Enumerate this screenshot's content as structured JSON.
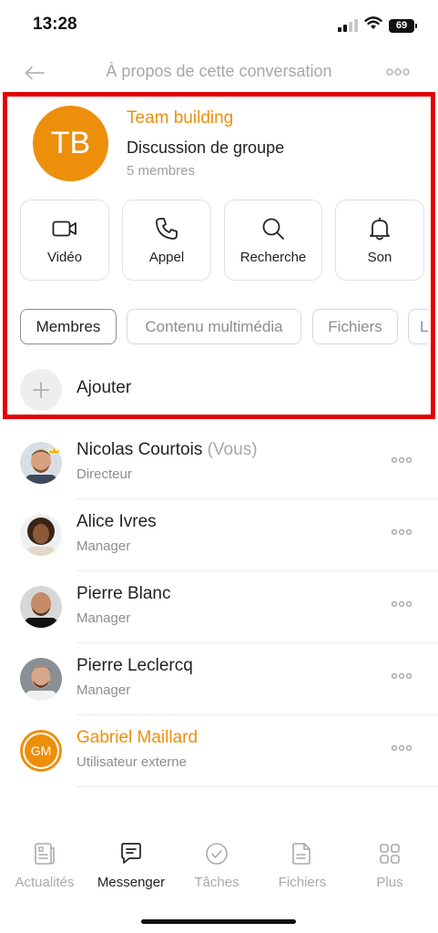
{
  "status_bar": {
    "time": "13:28",
    "battery": "69",
    "icons": [
      "signal-icon",
      "wifi-icon",
      "battery-icon"
    ]
  },
  "header": {
    "title": "À propos de cette conversation",
    "back_icon": "arrow-left-icon",
    "more_icon": "more-horizontal-icon"
  },
  "group": {
    "initials": "TB",
    "name": "Team building",
    "type": "Discussion de groupe",
    "member_count": "5 membres",
    "avatar_color": "#ed8f0b"
  },
  "actions": [
    {
      "label": "Vidéo",
      "icon": "video-camera-icon"
    },
    {
      "label": "Appel",
      "icon": "phone-icon"
    },
    {
      "label": "Recherche",
      "icon": "search-icon"
    },
    {
      "label": "Son",
      "icon": "bell-icon"
    }
  ],
  "tabs": [
    {
      "label": "Membres",
      "active": true
    },
    {
      "label": "Contenu multimédia",
      "active": false
    },
    {
      "label": "Fichiers",
      "active": false
    },
    {
      "label": "L",
      "active": false
    }
  ],
  "add_member": {
    "label": "Ajouter",
    "icon": "plus-icon"
  },
  "members": [
    {
      "name": "Nicolas Courtois",
      "suffix": "(Vous)",
      "role": "Directeur",
      "avatar": "photo",
      "badge": "crown-icon"
    },
    {
      "name": "Alice Ivres",
      "suffix": "",
      "role": "Manager",
      "avatar": "photo"
    },
    {
      "name": "Pierre Blanc",
      "suffix": "",
      "role": "Manager",
      "avatar": "photo"
    },
    {
      "name": "Pierre Leclercq",
      "suffix": "",
      "role": "Manager",
      "avatar": "photo"
    },
    {
      "name": "Gabriel Maillard",
      "suffix": "",
      "role": "Utilisateur externe",
      "initials": "GM",
      "external": true
    }
  ],
  "bottom_nav": [
    {
      "label": "Actualités",
      "icon": "news-icon",
      "active": false
    },
    {
      "label": "Messenger",
      "icon": "chat-icon",
      "active": true
    },
    {
      "label": "Tâches",
      "icon": "check-circle-icon",
      "active": false
    },
    {
      "label": "Fichiers",
      "icon": "file-icon",
      "active": false
    },
    {
      "label": "Plus",
      "icon": "grid-icon",
      "active": false
    }
  ],
  "colors": {
    "accent": "#ed8f0b",
    "highlight": "#e00000"
  }
}
